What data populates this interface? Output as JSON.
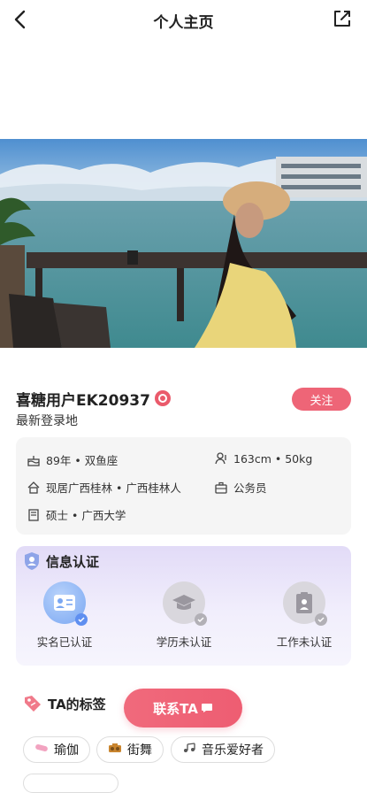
{
  "header": {
    "title": "个人主页"
  },
  "profile": {
    "name": "喜糖用户EK20937",
    "last_login": "最新登录地",
    "follow_label": "关注"
  },
  "info": {
    "birth": "89年 • 双鱼座",
    "body": "163cm • 50kg",
    "residence": "现居广西桂林 • 广西桂林人",
    "job": "公务员",
    "education": "硕士 • 广西大学"
  },
  "verification": {
    "title": "信息认证",
    "items": [
      {
        "label": "实名已认证",
        "verified": true
      },
      {
        "label": "学历未认证",
        "verified": false
      },
      {
        "label": "工作未认证",
        "verified": false
      }
    ]
  },
  "tags": {
    "title": "TA的标签",
    "contact_label": "联系TA",
    "items": [
      {
        "label": "瑜伽",
        "icon": "yoga-mat-icon"
      },
      {
        "label": "街舞",
        "icon": "boombox-icon"
      },
      {
        "label": "音乐爱好者",
        "icon": "music-note-icon"
      }
    ]
  },
  "colors": {
    "accent": "#ee6577",
    "verified": "#6b9bf0",
    "card_bg": "#f5f5f5"
  }
}
